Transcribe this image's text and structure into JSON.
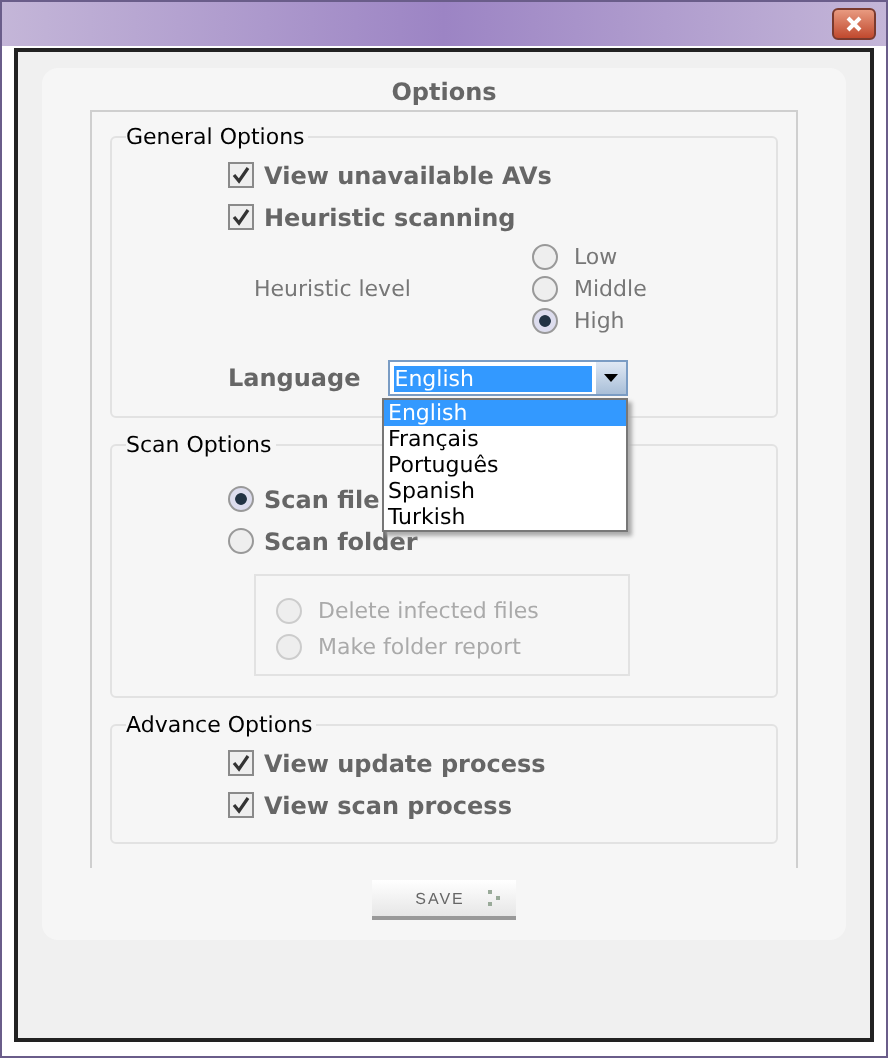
{
  "window": {
    "title": "Options"
  },
  "general": {
    "title": "General Options",
    "checks": [
      {
        "label": "View unavailable AVs",
        "checked": true
      },
      {
        "label": "Heuristic scanning",
        "checked": true
      }
    ],
    "heuristic_label": "Heuristic level",
    "levels": [
      {
        "label": "Low",
        "selected": false
      },
      {
        "label": "Middle",
        "selected": false
      },
      {
        "label": "High",
        "selected": true
      }
    ],
    "language": {
      "label": "Language",
      "value": "English",
      "expanded": true,
      "options": [
        {
          "label": "English",
          "selected": true
        },
        {
          "label": "Français",
          "selected": false
        },
        {
          "label": "Português",
          "selected": false
        },
        {
          "label": "Spanish",
          "selected": false
        },
        {
          "label": "Turkish",
          "selected": false
        }
      ]
    }
  },
  "scan": {
    "title": "Scan Options",
    "modes": [
      {
        "label": "Scan file",
        "selected": true
      },
      {
        "label": "Scan folder",
        "selected": false
      }
    ],
    "folder_options": [
      {
        "label": "Delete infected files",
        "selected": false,
        "disabled": true
      },
      {
        "label": "Make folder report",
        "selected": false,
        "disabled": true
      }
    ]
  },
  "advanced": {
    "title": "Advance Options",
    "checks": [
      {
        "label": "View update process",
        "checked": true
      },
      {
        "label": "View scan process",
        "checked": true
      }
    ]
  },
  "save_button": "SAVE"
}
